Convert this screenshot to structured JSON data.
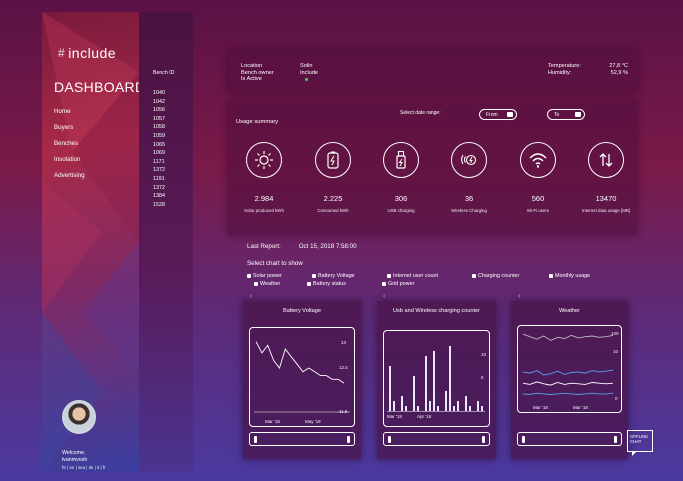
{
  "brand": {
    "name": "include",
    "dashboard": "DASHBOARD"
  },
  "nav": [
    "Home",
    "Buyers",
    "Benches",
    "Insolation",
    "Advertising"
  ],
  "user": {
    "welcome": "Welcome,",
    "name": "ivanmvosh",
    "langs": "hr | en | sea | de | it | fr"
  },
  "bench": {
    "header": "Bench ID",
    "ids": [
      "1040",
      "1042",
      "1056",
      "1057",
      "1058",
      "1059",
      "1065",
      "1069",
      "1171",
      "1372",
      "1191",
      "1372",
      "1384",
      "1528"
    ]
  },
  "info": {
    "location_label": "Location",
    "location_value": "Solin",
    "owner_label": "Bench owner",
    "owner_value": "Include",
    "active_label": "Is Active",
    "temp_label": "Temperature:",
    "temp_value": "27,8 °C",
    "humidity_label": "Humidity:",
    "humidity_value": "52,9 %",
    "active_color": "#3bd16f"
  },
  "usage": {
    "title": "Usage summary",
    "date_label": "Select date range:",
    "from": "From",
    "to": "To",
    "metrics": [
      {
        "icon": "sun-icon",
        "value": "2.984",
        "label": "Solar produced kWh"
      },
      {
        "icon": "battery-icon",
        "value": "2.225",
        "label": "Consumed kWh"
      },
      {
        "icon": "usb-charging-icon",
        "value": "306",
        "label": "USB charging"
      },
      {
        "icon": "wireless-charging-icon",
        "value": "36",
        "label": "Wireless Charging"
      },
      {
        "icon": "wifi-icon",
        "value": "560",
        "label": "Wi-Fi users"
      },
      {
        "icon": "data-transfer-icon",
        "value": "13470",
        "label": "Internet data usage [MB]"
      }
    ]
  },
  "report": {
    "label": "Last Report:",
    "value": "Oct 15, 2018 7:58:00"
  },
  "chart_select": {
    "title": "Select chart to show",
    "options": [
      "Solar power",
      "Battery Voltage",
      "Internet user count",
      "Charging counter",
      "Monthly usage",
      "Weather",
      "Battery status",
      "Grid power"
    ]
  },
  "charts": [
    {
      "title": "Battery Voltage",
      "x_ticks": [
        "Mar '18",
        "May '18"
      ],
      "y_ticks": [
        "13",
        "12.5",
        "11.5"
      ]
    },
    {
      "title": "Usb and Wireless charging counter",
      "x_ticks": [
        "Mar '18",
        "Apr '18"
      ],
      "y_ticks": [
        "10",
        "5"
      ]
    },
    {
      "title": "Weather",
      "x_ticks": [
        "Mar '18",
        "Mar '18"
      ],
      "y_ticks": [
        "100",
        "10",
        "0"
      ]
    }
  ],
  "chart_data": [
    {
      "type": "line",
      "title": "Battery Voltage",
      "x": [
        "Mar '18",
        "May '18"
      ],
      "series": [
        {
          "values": [
            13.1,
            12.8,
            13.0,
            12.6,
            12.4,
            12.9,
            12.7,
            12.5,
            12.3,
            12.4,
            12.3,
            12.2,
            12.2,
            12.1,
            12.1,
            12.0
          ]
        }
      ]
    },
    {
      "type": "bar",
      "title": "Usb and Wireless charging counter",
      "x": [
        "Mar '18",
        "Apr '18"
      ],
      "series": [
        {
          "values": [
            9,
            2,
            0,
            3,
            1,
            0,
            7,
            1,
            0,
            11,
            2,
            12,
            1,
            0,
            4,
            13,
            1,
            2,
            0,
            3,
            1,
            0,
            2,
            1
          ]
        }
      ]
    },
    {
      "type": "line",
      "title": "Weather",
      "x": [
        "Mar '18",
        "Mar '18"
      ],
      "series": [
        {
          "values": [
            100,
            96,
            92,
            97,
            90,
            95,
            93,
            98,
            94,
            96,
            97,
            95,
            96,
            98
          ]
        },
        {
          "values": [
            40,
            38,
            42,
            35,
            37,
            41,
            36,
            39,
            40,
            38,
            42,
            40,
            41,
            43
          ]
        },
        {
          "values": [
            22,
            20,
            24,
            21,
            19,
            23,
            20,
            22,
            21,
            20,
            23,
            22,
            21,
            22
          ]
        },
        {
          "values": [
            5,
            4,
            6,
            5,
            4,
            5,
            6,
            5,
            4,
            5,
            6,
            5,
            5,
            6
          ]
        }
      ]
    }
  ],
  "offline": {
    "label": "OFFLINE CHAT"
  },
  "colors": {
    "accent": "#ffffff",
    "weather_blue": "#5aa0e8",
    "weather_grey": "#b8b8c8"
  }
}
